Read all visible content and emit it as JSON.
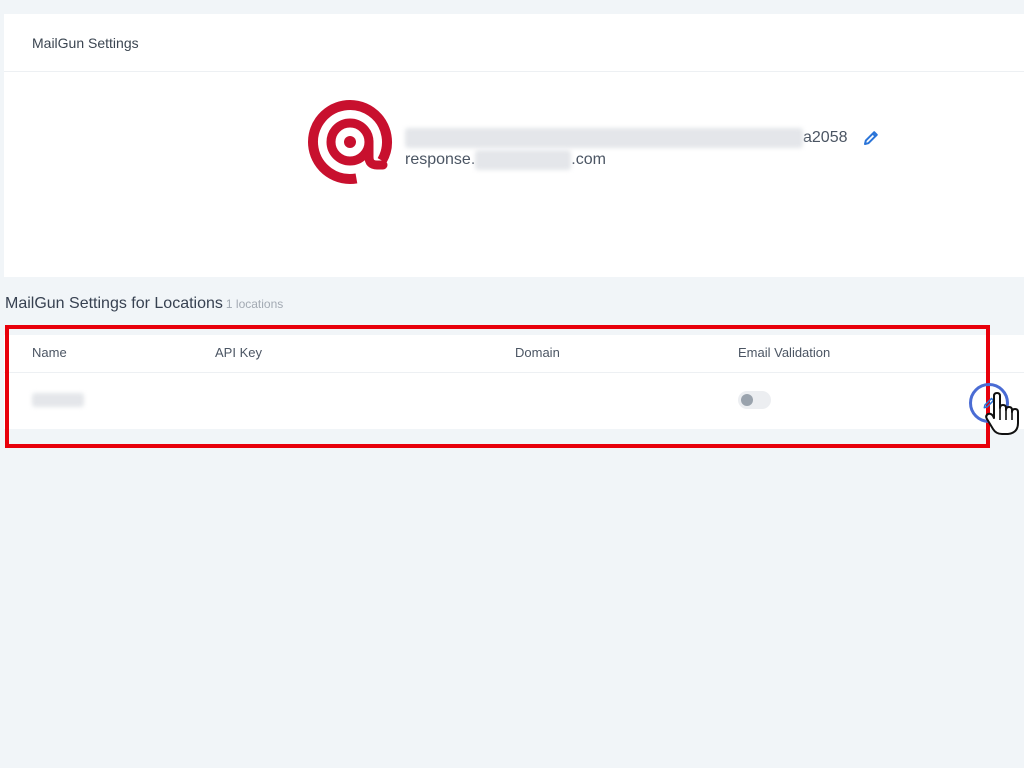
{
  "settings": {
    "title": "MailGun Settings",
    "api_key_suffix": "a2058",
    "domain_prefix": "response.",
    "domain_suffix": ".com",
    "edit_icon": "pencil-icon",
    "logo_icon": "mailgun-logo",
    "brand_color": "#c8102e"
  },
  "locations": {
    "title": "MailGun Settings for Locations",
    "count": "1 locations",
    "columns": [
      "Name",
      "API Key",
      "Domain",
      "Email Validation"
    ],
    "rows": [
      {
        "name": "",
        "api_key": "",
        "domain": "",
        "email_validation": false
      }
    ]
  },
  "accent_color": "#2a74d8",
  "highlight_color": "#e8000b"
}
